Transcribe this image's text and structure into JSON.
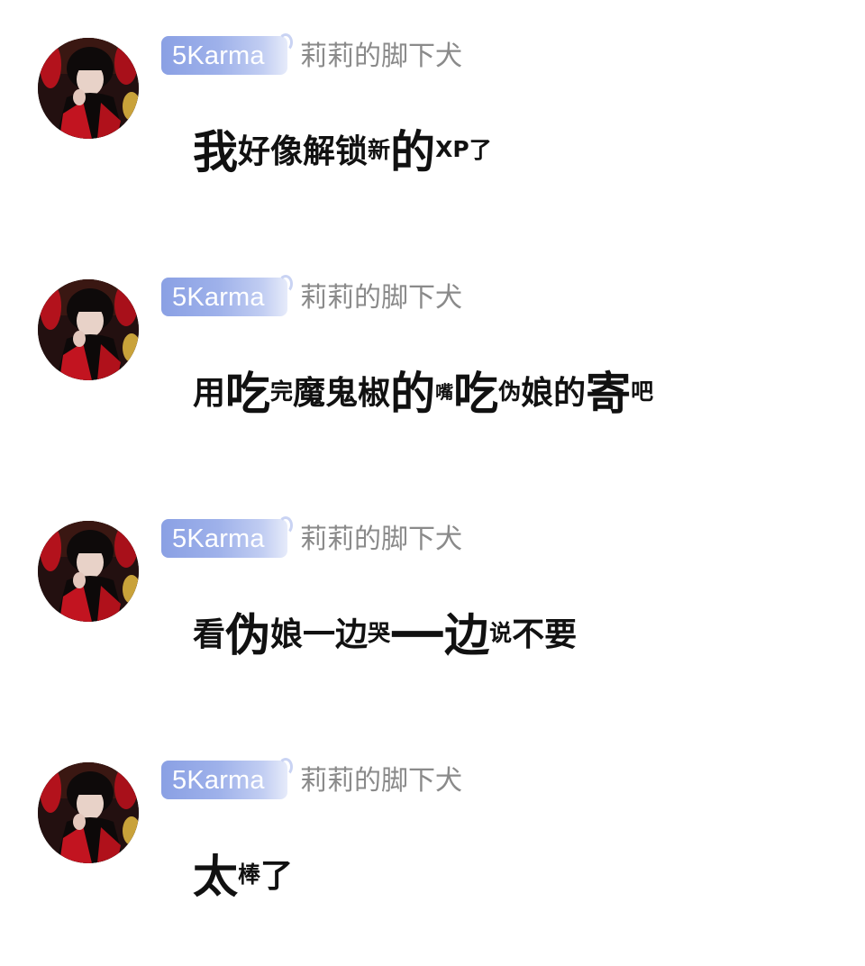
{
  "messages": [
    {
      "badge": "5Karma",
      "username": "莉莉的脚下犬",
      "content": "我好像解锁新的XP了",
      "segments": [
        {
          "t": "我",
          "s": "l"
        },
        {
          "t": "好",
          "s": "m"
        },
        {
          "t": "像",
          "s": "m"
        },
        {
          "t": "解",
          "s": "m"
        },
        {
          "t": "锁",
          "s": "m"
        },
        {
          "t": "新",
          "s": "s"
        },
        {
          "t": "的",
          "s": "l"
        },
        {
          "t": "XP",
          "s": "s"
        },
        {
          "t": "了",
          "s": "s"
        }
      ]
    },
    {
      "badge": "5Karma",
      "username": "莉莉的脚下犬",
      "content": "用吃完魔鬼椒的嘴吃伪娘的寄吧",
      "segments": [
        {
          "t": "用",
          "s": "m"
        },
        {
          "t": "吃",
          "s": "l"
        },
        {
          "t": "完",
          "s": "s"
        },
        {
          "t": "魔",
          "s": "m"
        },
        {
          "t": "鬼",
          "s": "m"
        },
        {
          "t": "椒",
          "s": "m"
        },
        {
          "t": "的",
          "s": "l"
        },
        {
          "t": "嘴",
          "s": "xs"
        },
        {
          "t": "吃",
          "s": "l"
        },
        {
          "t": "伪",
          "s": "s"
        },
        {
          "t": "娘",
          "s": "m"
        },
        {
          "t": "的",
          "s": "m"
        },
        {
          "t": "寄",
          "s": "l"
        },
        {
          "t": "吧",
          "s": "s"
        }
      ]
    },
    {
      "badge": "5Karma",
      "username": "莉莉的脚下犬",
      "content": "看伪娘一边哭一边说不要",
      "segments": [
        {
          "t": "看",
          "s": "m"
        },
        {
          "t": "伪",
          "s": "l"
        },
        {
          "t": "娘",
          "s": "m"
        },
        {
          "t": "一",
          "s": "m"
        },
        {
          "t": "边",
          "s": "m"
        },
        {
          "t": "哭",
          "s": "s"
        },
        {
          "t": "一",
          "s": "xl"
        },
        {
          "t": "边",
          "s": "l"
        },
        {
          "t": "说",
          "s": "s"
        },
        {
          "t": "不",
          "s": "m"
        },
        {
          "t": "要",
          "s": "m"
        }
      ]
    },
    {
      "badge": "5Karma",
      "username": "莉莉的脚下犬",
      "content": "太棒了",
      "segments": [
        {
          "t": "太",
          "s": "l"
        },
        {
          "t": "棒",
          "s": "s"
        },
        {
          "t": "了",
          "s": "m"
        }
      ]
    }
  ],
  "colors": {
    "badge_start": "#8aa0e4",
    "badge_end": "#e6ebfa",
    "username": "#8a8a8a",
    "content": "#111111"
  },
  "icons": {
    "avatar": "user-avatar-photo",
    "badge_orb": "badge-orb-icon"
  }
}
